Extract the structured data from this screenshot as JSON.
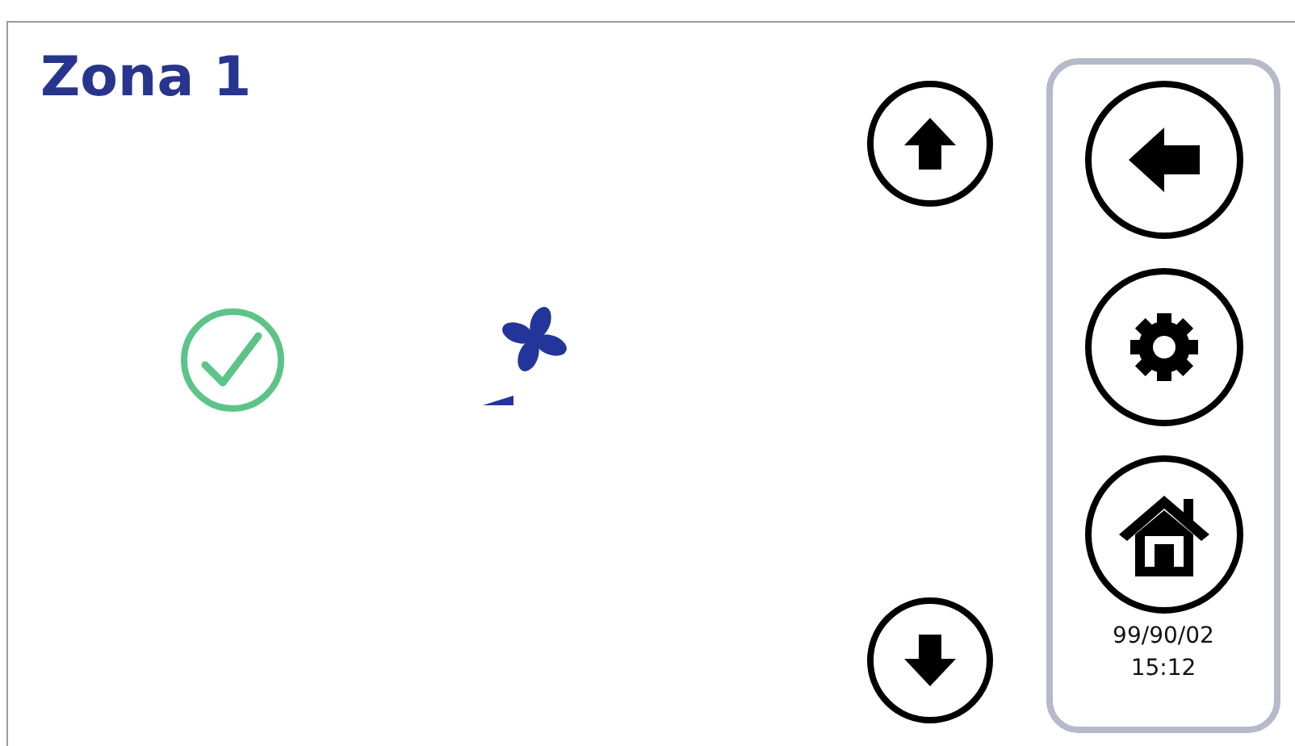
{
  "title": "Zona 1",
  "panel": {
    "date": "99/90/02",
    "time": "15:12"
  }
}
